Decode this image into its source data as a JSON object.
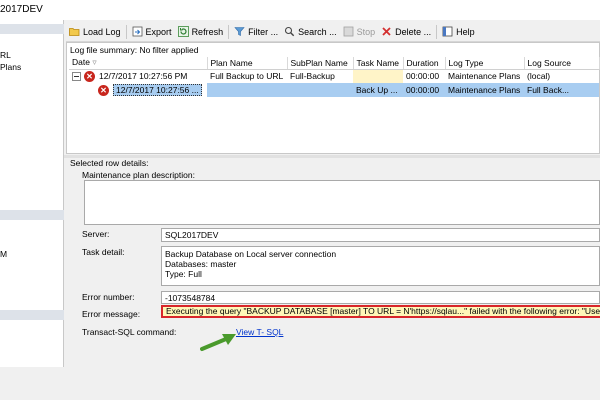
{
  "window": {
    "title": "2017DEV"
  },
  "left_pane": {
    "items": [
      "RL",
      "Plans",
      "M"
    ]
  },
  "toolbar": {
    "load_log": "Load Log",
    "export": "Export",
    "refresh": "Refresh",
    "filter": "Filter ...",
    "search": "Search ...",
    "stop": "Stop",
    "delete": "Delete ...",
    "help": "Help"
  },
  "log": {
    "summary": "Log file summary: No filter applied",
    "columns": [
      "Date",
      "Plan Name",
      "SubPlan Name",
      "Task Name",
      "Duration",
      "Log Type",
      "Log Source"
    ],
    "rows": [
      {
        "date": "12/7/2017 10:27:56 PM",
        "plan": "Full Backup to URL",
        "subplan": "Full-Backup",
        "task": "",
        "duration": "00:00:00",
        "log_type": "Maintenance Plans",
        "log_source": "(local)"
      },
      {
        "date": "12/7/2017 10:27:56 ...",
        "plan": "",
        "subplan": "",
        "task": "Back Up ...",
        "duration": "00:00:00",
        "log_type": "Maintenance Plans",
        "log_source": "Full Back..."
      }
    ]
  },
  "details": {
    "heading": "Selected row details:",
    "mp_description_label": "Maintenance plan description:",
    "server_label": "Server:",
    "server_value": "SQL2017DEV",
    "task_detail_label": "Task detail:",
    "task_detail_lines": [
      "Backup Database on Local server connection",
      "Databases: master",
      "Type: Full"
    ],
    "error_number_label": "Error number:",
    "error_number_value": "-1073548784",
    "error_message_label": "Error message:",
    "error_message_value": "Executing the query \"BACKUP DATABASE [master] TO  URL = N'https://sqlau...\" failed with the following error: \"Use of WITH",
    "tsql_label": "Transact-SQL command:",
    "tsql_link": "View T- SQL"
  },
  "colors": {
    "selection": "#a8cdf1",
    "error_highlight_border": "#d8262a",
    "error_highlight_fill": "#fff7b8",
    "annotation_arrow": "#4a9a2c",
    "link": "#0033cc"
  }
}
